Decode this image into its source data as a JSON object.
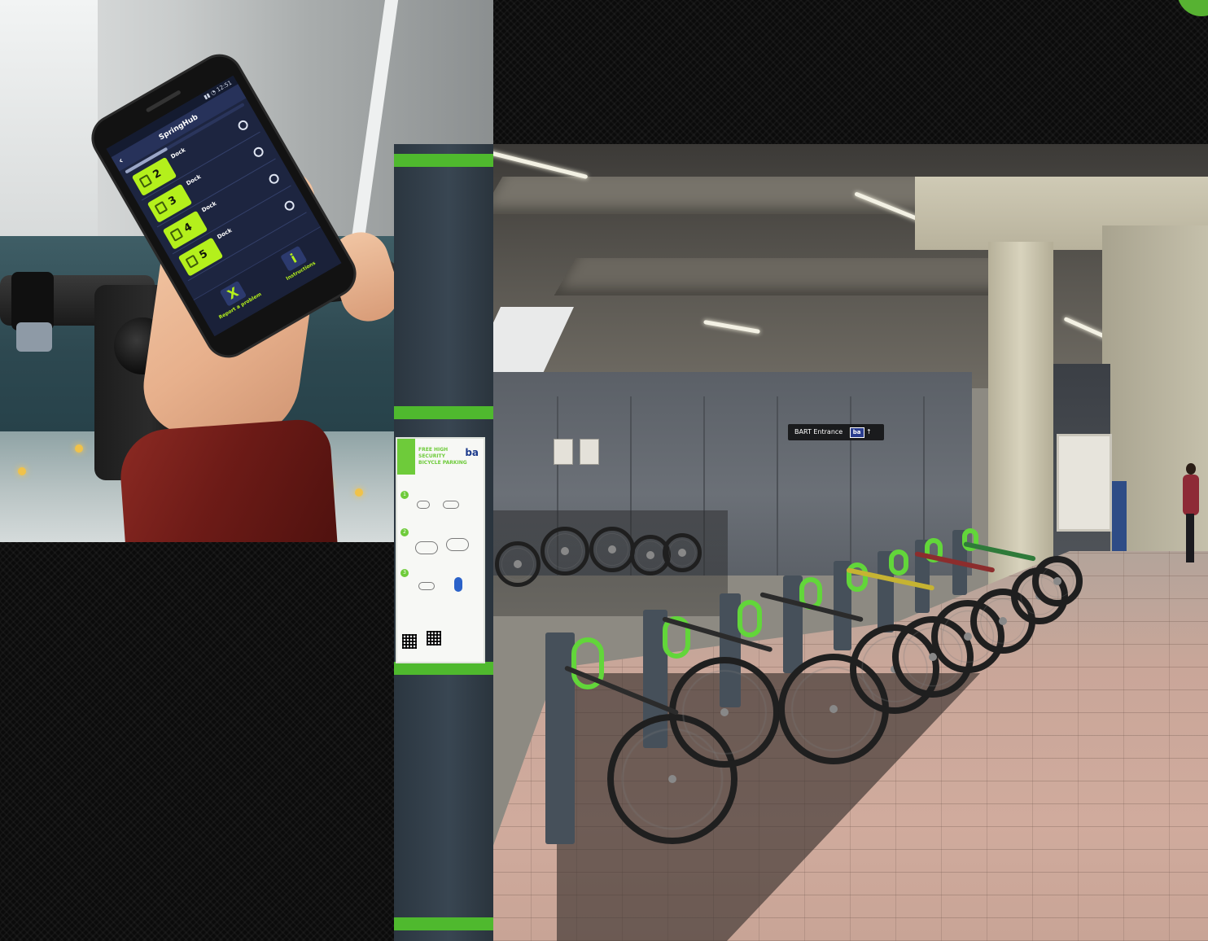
{
  "phone_app": {
    "header_title": "SpringHub",
    "progress_fraction": 0.35,
    "docks": [
      {
        "number": "2",
        "label": "Dock"
      },
      {
        "number": "3",
        "label": "Dock"
      },
      {
        "number": "4",
        "label": "Dock"
      },
      {
        "number": "5",
        "label": "Dock"
      }
    ],
    "actions": [
      {
        "glyph": "X",
        "label": "Report a problem",
        "icon": "close-icon"
      },
      {
        "glyph": "i",
        "label": "Instructions",
        "icon": "info-icon"
      }
    ],
    "tile_color": "#b4f01c",
    "screen_color": "#1d2540"
  },
  "station": {
    "bart_sign": "BART Entrance",
    "bart_logo": "ba",
    "poster_logo": "ba",
    "poster_title": "FREE HIGH SECURITY BICYCLE PARKING",
    "poster_steps": [
      "1",
      "2",
      "3"
    ],
    "accent_color": "#4fb92e"
  }
}
